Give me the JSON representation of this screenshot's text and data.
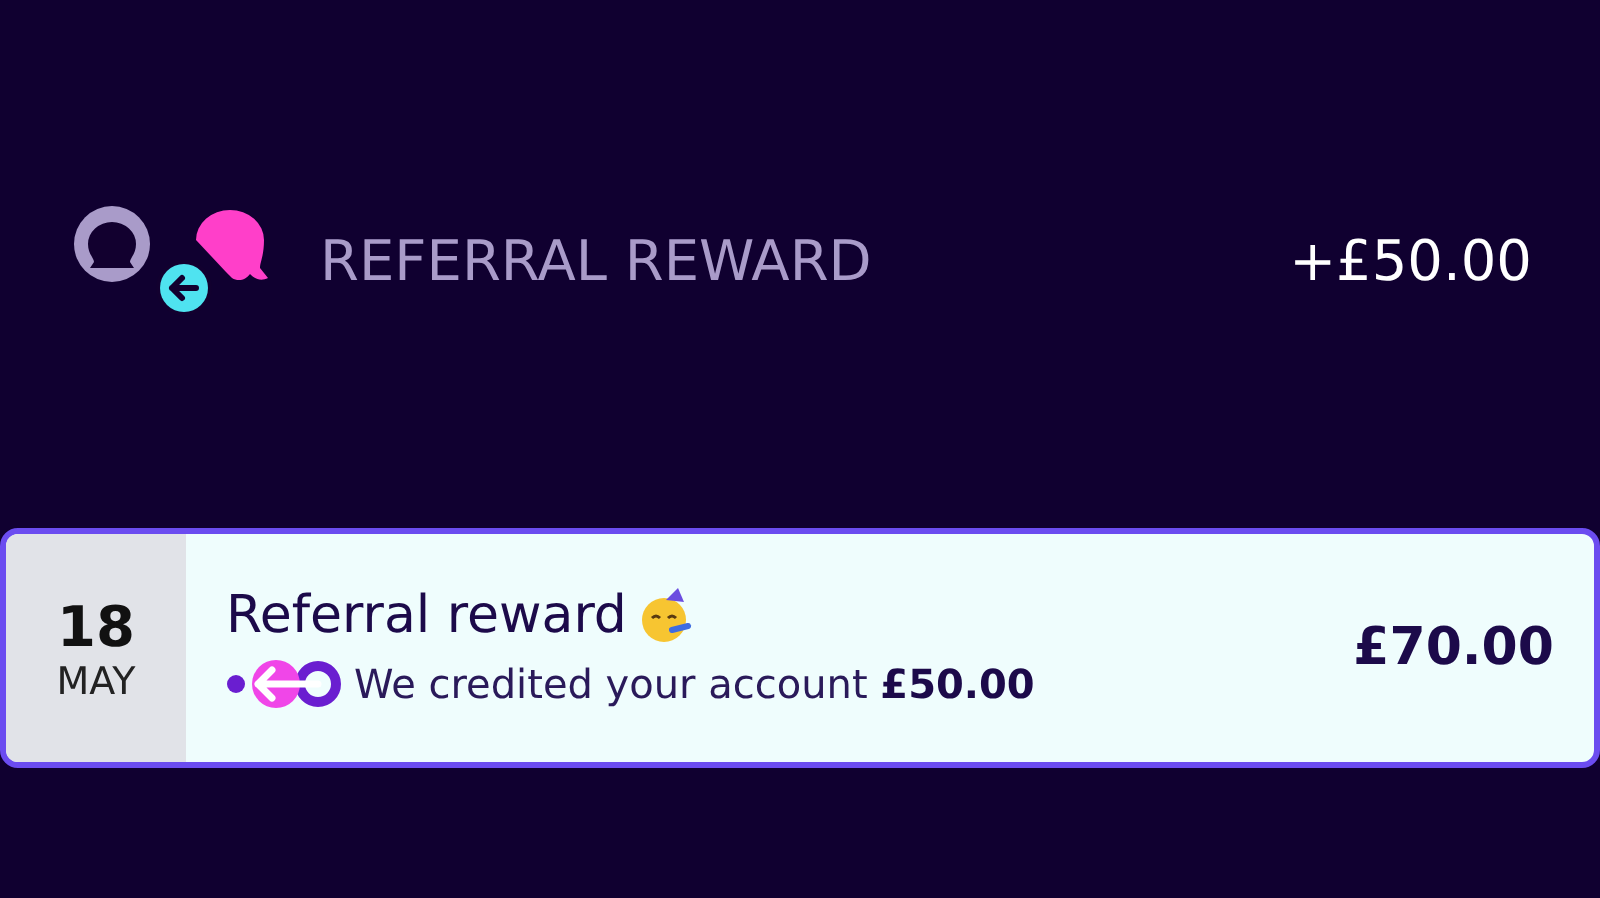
{
  "header": {
    "title": "REFERRAL REWARD",
    "amount": "+£50.00"
  },
  "transaction": {
    "day": "18",
    "month": "MAY",
    "title": "Referral reward",
    "description": "We credited your account **£50.00**",
    "amount": "£70.00"
  }
}
